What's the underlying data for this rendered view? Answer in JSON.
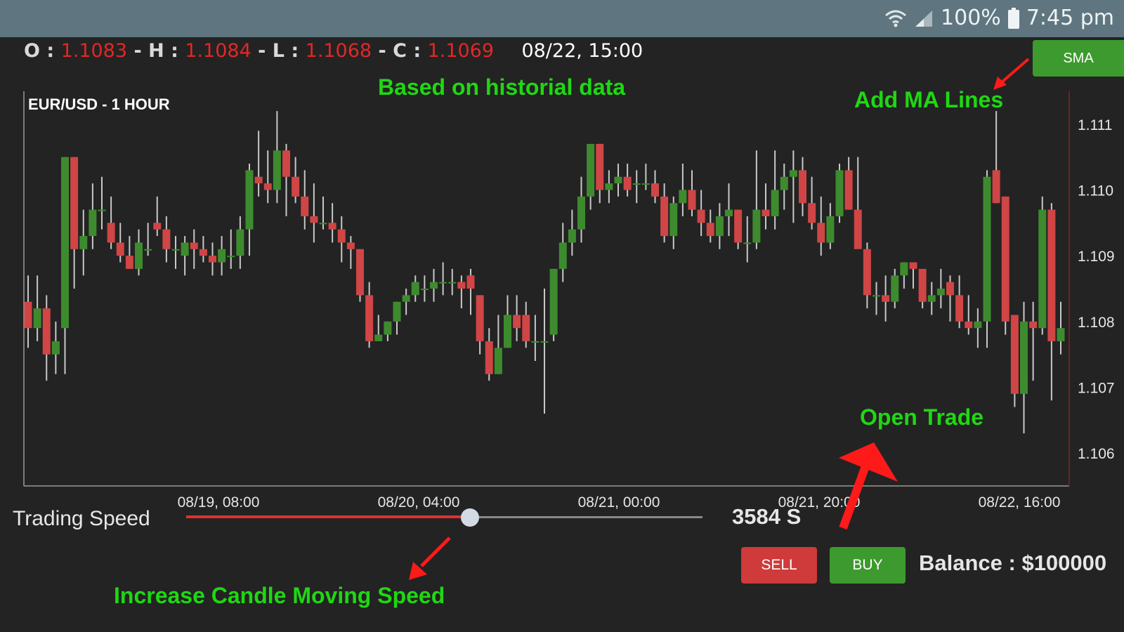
{
  "status_bar": {
    "battery": "100%",
    "time": "7:45 pm",
    "icons": [
      "wifi-icon",
      "signal-icon",
      "battery-icon"
    ]
  },
  "ohlc": {
    "o_label": "O :",
    "o": "1.1083",
    "h_label": "H :",
    "h": "1.1084",
    "l_label": "L :",
    "l": "1.1068",
    "c_label": "C :",
    "c": "1.1069",
    "sep": "-",
    "datetime": "08/22, 15:00"
  },
  "sma_button": "SMA",
  "annotations": {
    "historical": "Based  on historial data",
    "ma_lines": "Add MA Lines",
    "open_trade": "Open Trade",
    "speed": "Increase Candle Moving Speed"
  },
  "trading": {
    "speed_label": "Trading Speed",
    "speed_value": "3584 S",
    "speed_fraction": 0.55,
    "sell": "SELL",
    "buy": "BUY",
    "balance": "Balance : $100000"
  },
  "colors": {
    "up": "#3d8b2e",
    "down": "#d04545",
    "wick": "#c8c8c8",
    "annotation": "#1fd812",
    "arrow": "#ff1a1a"
  },
  "chart_data": {
    "type": "candlestick",
    "title": "EUR/USD - 1 HOUR",
    "ylim": [
      1.1055,
      1.1115
    ],
    "y_ticks": [
      "1.111",
      "1.110",
      "1.109",
      "1.108",
      "1.107",
      "1.106"
    ],
    "x_tick_labels": [
      "08/19, 08:00",
      "08/20, 04:00",
      "08/21, 00:00",
      "08/21, 20:00",
      "08/22, 16:00"
    ],
    "candles": [
      {
        "o": 1.1083,
        "h": 1.1087,
        "l": 1.1076,
        "c": 1.1079
      },
      {
        "o": 1.1079,
        "h": 1.1087,
        "l": 1.1077,
        "c": 1.1082
      },
      {
        "o": 1.1082,
        "h": 1.1084,
        "l": 1.1071,
        "c": 1.1075
      },
      {
        "o": 1.1075,
        "h": 1.108,
        "l": 1.1072,
        "c": 1.1077
      },
      {
        "o": 1.1079,
        "h": 1.1105,
        "l": 1.1072,
        "c": 1.1105
      },
      {
        "o": 1.1105,
        "h": 1.1105,
        "l": 1.1085,
        "c": 1.1091
      },
      {
        "o": 1.1091,
        "h": 1.1097,
        "l": 1.1087,
        "c": 1.1093
      },
      {
        "o": 1.1093,
        "h": 1.1101,
        "l": 1.1091,
        "c": 1.1097
      },
      {
        "o": 1.1097,
        "h": 1.1102,
        "l": 1.1094,
        "c": 1.1097
      },
      {
        "o": 1.1095,
        "h": 1.1099,
        "l": 1.1091,
        "c": 1.1092
      },
      {
        "o": 1.1092,
        "h": 1.1095,
        "l": 1.1089,
        "c": 1.109
      },
      {
        "o": 1.109,
        "h": 1.1093,
        "l": 1.1088,
        "c": 1.1088
      },
      {
        "o": 1.1088,
        "h": 1.1094,
        "l": 1.1087,
        "c": 1.1092
      },
      {
        "o": 1.1091,
        "h": 1.1095,
        "l": 1.109,
        "c": 1.1091
      },
      {
        "o": 1.1095,
        "h": 1.1099,
        "l": 1.1093,
        "c": 1.1094
      },
      {
        "o": 1.1094,
        "h": 1.1096,
        "l": 1.1089,
        "c": 1.1091
      },
      {
        "o": 1.1091,
        "h": 1.1093,
        "l": 1.1088,
        "c": 1.1091
      },
      {
        "o": 1.109,
        "h": 1.1093,
        "l": 1.1087,
        "c": 1.1092
      },
      {
        "o": 1.1092,
        "h": 1.1094,
        "l": 1.1088,
        "c": 1.1091
      },
      {
        "o": 1.1091,
        "h": 1.1093,
        "l": 1.1089,
        "c": 1.109
      },
      {
        "o": 1.109,
        "h": 1.1092,
        "l": 1.1087,
        "c": 1.1089
      },
      {
        "o": 1.1089,
        "h": 1.1093,
        "l": 1.1087,
        "c": 1.1091
      },
      {
        "o": 1.109,
        "h": 1.1094,
        "l": 1.1088,
        "c": 1.109
      },
      {
        "o": 1.109,
        "h": 1.1096,
        "l": 1.1088,
        "c": 1.1094
      },
      {
        "o": 1.1094,
        "h": 1.1104,
        "l": 1.109,
        "c": 1.1103
      },
      {
        "o": 1.1102,
        "h": 1.1109,
        "l": 1.1099,
        "c": 1.1101
      },
      {
        "o": 1.1101,
        "h": 1.1106,
        "l": 1.1098,
        "c": 1.11
      },
      {
        "o": 1.11,
        "h": 1.1112,
        "l": 1.1098,
        "c": 1.1106
      },
      {
        "o": 1.1106,
        "h": 1.1107,
        "l": 1.1096,
        "c": 1.1102
      },
      {
        "o": 1.1102,
        "h": 1.1105,
        "l": 1.1098,
        "c": 1.1099
      },
      {
        "o": 1.1099,
        "h": 1.1103,
        "l": 1.1094,
        "c": 1.1096
      },
      {
        "o": 1.1096,
        "h": 1.1101,
        "l": 1.1092,
        "c": 1.1095
      },
      {
        "o": 1.1095,
        "h": 1.1099,
        "l": 1.1094,
        "c": 1.1095
      },
      {
        "o": 1.1095,
        "h": 1.1098,
        "l": 1.1092,
        "c": 1.1094
      },
      {
        "o": 1.1094,
        "h": 1.1096,
        "l": 1.1089,
        "c": 1.1092
      },
      {
        "o": 1.1092,
        "h": 1.1093,
        "l": 1.1088,
        "c": 1.1091
      },
      {
        "o": 1.1091,
        "h": 1.1091,
        "l": 1.1083,
        "c": 1.1084
      },
      {
        "o": 1.1084,
        "h": 1.1086,
        "l": 1.1076,
        "c": 1.1077
      },
      {
        "o": 1.1077,
        "h": 1.1081,
        "l": 1.1077,
        "c": 1.1078
      },
      {
        "o": 1.1078,
        "h": 1.108,
        "l": 1.1077,
        "c": 1.108
      },
      {
        "o": 1.108,
        "h": 1.1083,
        "l": 1.1078,
        "c": 1.1083
      },
      {
        "o": 1.1083,
        "h": 1.1085,
        "l": 1.1081,
        "c": 1.1084
      },
      {
        "o": 1.1084,
        "h": 1.1087,
        "l": 1.1083,
        "c": 1.1086
      },
      {
        "o": 1.1085,
        "h": 1.1087,
        "l": 1.1083,
        "c": 1.1085
      },
      {
        "o": 1.1085,
        "h": 1.1088,
        "l": 1.1083,
        "c": 1.1086
      },
      {
        "o": 1.1086,
        "h": 1.1089,
        "l": 1.1084,
        "c": 1.1086
      },
      {
        "o": 1.1086,
        "h": 1.1088,
        "l": 1.1084,
        "c": 1.1086
      },
      {
        "o": 1.1086,
        "h": 1.1087,
        "l": 1.1082,
        "c": 1.1085
      },
      {
        "o": 1.1087,
        "h": 1.1088,
        "l": 1.1081,
        "c": 1.1085
      },
      {
        "o": 1.1084,
        "h": 1.1084,
        "l": 1.1075,
        "c": 1.1077
      },
      {
        "o": 1.1077,
        "h": 1.1079,
        "l": 1.1071,
        "c": 1.1072
      },
      {
        "o": 1.1072,
        "h": 1.1081,
        "l": 1.1072,
        "c": 1.1076
      },
      {
        "o": 1.1076,
        "h": 1.1084,
        "l": 1.1076,
        "c": 1.1081
      },
      {
        "o": 1.1081,
        "h": 1.1084,
        "l": 1.1077,
        "c": 1.1079
      },
      {
        "o": 1.1081,
        "h": 1.1083,
        "l": 1.1076,
        "c": 1.1077
      },
      {
        "o": 1.1077,
        "h": 1.1081,
        "l": 1.1074,
        "c": 1.1077
      },
      {
        "o": 1.1077,
        "h": 1.1085,
        "l": 1.1066,
        "c": 1.1077
      },
      {
        "o": 1.1078,
        "h": 1.1088,
        "l": 1.1077,
        "c": 1.1088
      },
      {
        "o": 1.1088,
        "h": 1.1095,
        "l": 1.1086,
        "c": 1.1092
      },
      {
        "o": 1.1092,
        "h": 1.1097,
        "l": 1.109,
        "c": 1.1094
      },
      {
        "o": 1.1094,
        "h": 1.1102,
        "l": 1.1092,
        "c": 1.1099
      },
      {
        "o": 1.1099,
        "h": 1.1106,
        "l": 1.1097,
        "c": 1.1107
      },
      {
        "o": 1.1107,
        "h": 1.1107,
        "l": 1.1098,
        "c": 1.11
      },
      {
        "o": 1.11,
        "h": 1.1103,
        "l": 1.1098,
        "c": 1.1101
      },
      {
        "o": 1.1101,
        "h": 1.1104,
        "l": 1.1099,
        "c": 1.1102
      },
      {
        "o": 1.1102,
        "h": 1.1104,
        "l": 1.1099,
        "c": 1.11
      },
      {
        "o": 1.1101,
        "h": 1.1103,
        "l": 1.1098,
        "c": 1.1101
      },
      {
        "o": 1.1101,
        "h": 1.1104,
        "l": 1.11,
        "c": 1.1101
      },
      {
        "o": 1.1101,
        "h": 1.1103,
        "l": 1.1098,
        "c": 1.1099
      },
      {
        "o": 1.1099,
        "h": 1.1101,
        "l": 1.1092,
        "c": 1.1093
      },
      {
        "o": 1.1093,
        "h": 1.1099,
        "l": 1.1091,
        "c": 1.1098
      },
      {
        "o": 1.1098,
        "h": 1.1104,
        "l": 1.1096,
        "c": 1.11
      },
      {
        "o": 1.11,
        "h": 1.1103,
        "l": 1.1096,
        "c": 1.1097
      },
      {
        "o": 1.1097,
        "h": 1.11,
        "l": 1.1093,
        "c": 1.1095
      },
      {
        "o": 1.1095,
        "h": 1.1097,
        "l": 1.1092,
        "c": 1.1093
      },
      {
        "o": 1.1093,
        "h": 1.1098,
        "l": 1.1091,
        "c": 1.1096
      },
      {
        "o": 1.1096,
        "h": 1.1101,
        "l": 1.1093,
        "c": 1.1097
      },
      {
        "o": 1.1097,
        "h": 1.1097,
        "l": 1.1091,
        "c": 1.1092
      },
      {
        "o": 1.1092,
        "h": 1.1096,
        "l": 1.1089,
        "c": 1.1092
      },
      {
        "o": 1.1092,
        "h": 1.1106,
        "l": 1.1091,
        "c": 1.1097
      },
      {
        "o": 1.1097,
        "h": 1.1101,
        "l": 1.1094,
        "c": 1.1096
      },
      {
        "o": 1.1096,
        "h": 1.1106,
        "l": 1.1094,
        "c": 1.11
      },
      {
        "o": 1.11,
        "h": 1.1104,
        "l": 1.1097,
        "c": 1.1102
      },
      {
        "o": 1.1102,
        "h": 1.1106,
        "l": 1.1095,
        "c": 1.1103
      },
      {
        "o": 1.1103,
        "h": 1.1105,
        "l": 1.1096,
        "c": 1.1098
      },
      {
        "o": 1.1098,
        "h": 1.1102,
        "l": 1.1094,
        "c": 1.1095
      },
      {
        "o": 1.1095,
        "h": 1.1099,
        "l": 1.109,
        "c": 1.1092
      },
      {
        "o": 1.1092,
        "h": 1.1098,
        "l": 1.1091,
        "c": 1.1096
      },
      {
        "o": 1.1096,
        "h": 1.1104,
        "l": 1.1095,
        "c": 1.1103
      },
      {
        "o": 1.1103,
        "h": 1.1105,
        "l": 1.1097,
        "c": 1.1097
      },
      {
        "o": 1.1097,
        "h": 1.1105,
        "l": 1.1094,
        "c": 1.1091
      },
      {
        "o": 1.1091,
        "h": 1.1092,
        "l": 1.1082,
        "c": 1.1084
      },
      {
        "o": 1.1084,
        "h": 1.1086,
        "l": 1.1081,
        "c": 1.1084
      },
      {
        "o": 1.1084,
        "h": 1.1087,
        "l": 1.108,
        "c": 1.1083
      },
      {
        "o": 1.1083,
        "h": 1.1088,
        "l": 1.1082,
        "c": 1.1087
      },
      {
        "o": 1.1087,
        "h": 1.1089,
        "l": 1.1085,
        "c": 1.1089
      },
      {
        "o": 1.1089,
        "h": 1.1089,
        "l": 1.1085,
        "c": 1.1088
      },
      {
        "o": 1.1088,
        "h": 1.1088,
        "l": 1.1082,
        "c": 1.1083
      },
      {
        "o": 1.1083,
        "h": 1.1086,
        "l": 1.1081,
        "c": 1.1084
      },
      {
        "o": 1.1084,
        "h": 1.1088,
        "l": 1.1082,
        "c": 1.1085
      },
      {
        "o": 1.1086,
        "h": 1.1087,
        "l": 1.108,
        "c": 1.1084
      },
      {
        "o": 1.1084,
        "h": 1.1087,
        "l": 1.1079,
        "c": 1.108
      },
      {
        "o": 1.108,
        "h": 1.1084,
        "l": 1.1078,
        "c": 1.1079
      },
      {
        "o": 1.1079,
        "h": 1.1082,
        "l": 1.1076,
        "c": 1.108
      },
      {
        "o": 1.108,
        "h": 1.1103,
        "l": 1.1076,
        "c": 1.1102
      },
      {
        "o": 1.1103,
        "h": 1.1112,
        "l": 1.1098,
        "c": 1.1098
      },
      {
        "o": 1.1099,
        "h": 1.1099,
        "l": 1.1078,
        "c": 1.108
      },
      {
        "o": 1.1081,
        "h": 1.1081,
        "l": 1.1067,
        "c": 1.1069
      },
      {
        "o": 1.1069,
        "h": 1.1083,
        "l": 1.1063,
        "c": 1.108
      },
      {
        "o": 1.108,
        "h": 1.1083,
        "l": 1.1071,
        "c": 1.1079
      },
      {
        "o": 1.1079,
        "h": 1.1099,
        "l": 1.1078,
        "c": 1.1097
      },
      {
        "o": 1.1097,
        "h": 1.1098,
        "l": 1.1068,
        "c": 1.1077
      },
      {
        "o": 1.1077,
        "h": 1.1083,
        "l": 1.1075,
        "c": 1.1079
      }
    ]
  }
}
